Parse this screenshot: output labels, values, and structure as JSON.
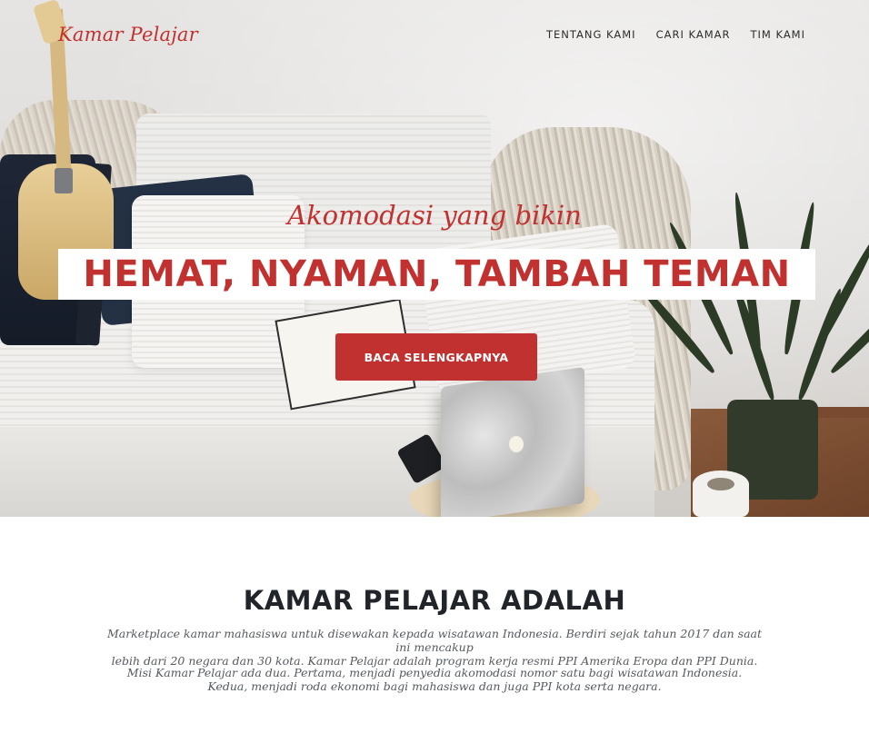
{
  "brand": {
    "logo_text": "Kamar Pelajar",
    "accent_color": "#c0312f"
  },
  "nav": {
    "items": [
      {
        "label": "TENTANG KAMI"
      },
      {
        "label": "CARI KAMAR"
      },
      {
        "label": "TIM KAMI"
      }
    ]
  },
  "hero": {
    "subtitle": "Akomodasi yang bikin",
    "title": "HEMAT, NYAMAN, TAMBAH TEMAN",
    "cta_label": "BACA SELENGKAPNYA"
  },
  "about": {
    "title": "KAMAR PELAJAR ADALAH",
    "paragraph1_line1": "Marketplace kamar mahasiswa untuk disewakan kepada wisatawan Indonesia. Berdiri sejak tahun 2017 dan saat ini mencakup",
    "paragraph1_line2": "lebih dari 20 negara dan 30 kota. Kamar Pelajar adalah program kerja resmi PPI Amerika Eropa dan PPI Dunia.",
    "paragraph2_line1": "Misi Kamar Pelajar ada dua. Pertama, menjadi penyedia akomodasi nomor satu bagi wisatawan Indonesia.",
    "paragraph2_line2": "Kedua, menjadi roda ekonomi bagi mahasiswa dan juga PPI kota serta negara."
  }
}
